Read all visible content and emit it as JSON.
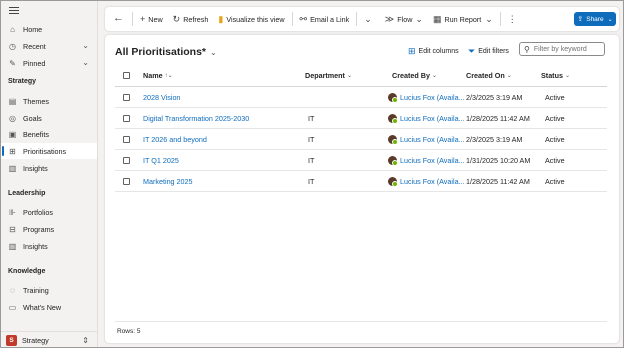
{
  "sidebar": {
    "items_top": [
      {
        "label": "Home",
        "icon": "home-icon"
      },
      {
        "label": "Recent",
        "icon": "clock-icon",
        "chevron": true
      },
      {
        "label": "Pinned",
        "icon": "pin-icon",
        "chevron": true
      }
    ],
    "sections": [
      {
        "title": "Strategy",
        "items": [
          {
            "label": "Themes",
            "icon": "layers-icon"
          },
          {
            "label": "Goals",
            "icon": "target-icon"
          },
          {
            "label": "Benefits",
            "icon": "gift-icon"
          },
          {
            "label": "Prioritisations",
            "icon": "table-icon",
            "active": true
          },
          {
            "label": "Insights",
            "icon": "chart-icon"
          }
        ]
      },
      {
        "title": "Leadership",
        "items": [
          {
            "label": "Portfolios",
            "icon": "portfolio-icon"
          },
          {
            "label": "Programs",
            "icon": "programs-icon"
          },
          {
            "label": "Insights",
            "icon": "chart-icon"
          }
        ]
      },
      {
        "title": "Knowledge",
        "items": [
          {
            "label": "Training",
            "icon": "training-icon"
          },
          {
            "label": "What's New",
            "icon": "news-icon"
          }
        ]
      }
    ],
    "area": {
      "badge": "S",
      "label": "Strategy"
    }
  },
  "commandbar": {
    "new": "New",
    "refresh": "Refresh",
    "visualize": "Visualize this view",
    "email_link": "Email a Link",
    "flow": "Flow",
    "run_report": "Run Report",
    "share": "Share"
  },
  "view": {
    "title": "All Prioritisations*",
    "edit_columns": "Edit columns",
    "edit_filters": "Edit filters",
    "search_placeholder": "Filter by keyword"
  },
  "grid": {
    "columns": [
      "Name",
      "Department",
      "Created By",
      "Created On",
      "Status"
    ],
    "rows": [
      {
        "name": "2028 Vision",
        "department": "",
        "created_by": "Lucius Fox (Availa...",
        "created_on": "2/3/2025 3:19 AM",
        "status": "Active"
      },
      {
        "name": "Digital Transformation 2025-2030",
        "department": "IT",
        "created_by": "Lucius Fox (Availa...",
        "created_on": "1/28/2025 11:42 AM",
        "status": "Active"
      },
      {
        "name": "IT 2026 and beyond",
        "department": "IT",
        "created_by": "Lucius Fox (Availa...",
        "created_on": "2/3/2025 3:19 AM",
        "status": "Active"
      },
      {
        "name": "IT Q1 2025",
        "department": "IT",
        "created_by": "Lucius Fox (Availa...",
        "created_on": "1/31/2025 10:20 AM",
        "status": "Active"
      },
      {
        "name": "Marketing 2025",
        "department": "IT",
        "created_by": "Lucius Fox (Availa...",
        "created_on": "1/28/2025 11:42 AM",
        "status": "Active"
      }
    ],
    "footer": "Rows: 5"
  },
  "colors": {
    "accent": "#0f6cbd",
    "area_badge": "#c0392b",
    "presence": "#6bb700"
  }
}
